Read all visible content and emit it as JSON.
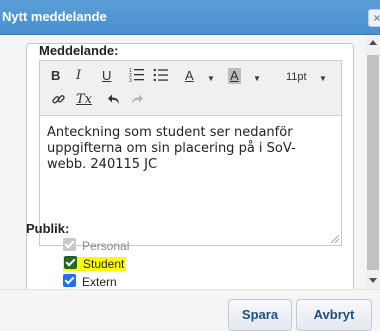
{
  "dialog": {
    "title": "Nytt meddelande",
    "close_glyph": "×"
  },
  "editor": {
    "label": "Meddelande:",
    "toolbar": {
      "bold": "B",
      "italic": "I",
      "underline": "U",
      "font_color": "A",
      "bg_color": "A",
      "font_size": "11pt",
      "caret": "▼",
      "clear_format": "Tx"
    },
    "text": "Anteckning som student ser nedanför\nuppgifterna om sin placering på i SoV-\nwebb. 240115 JC"
  },
  "audience": {
    "label": "Publik:",
    "options": [
      {
        "label": "Personal",
        "checked": true,
        "disabled": true
      },
      {
        "label": "Student",
        "checked": true,
        "disabled": false,
        "highlighted": true
      },
      {
        "label": "Extern",
        "checked": true,
        "disabled": false
      }
    ]
  },
  "buttons": {
    "save": "Spara",
    "cancel": "Avbryt"
  },
  "colors": {
    "titlebar": "#4a8fcf",
    "highlight": "#ffff00",
    "checkbox": "#1a73e8"
  }
}
